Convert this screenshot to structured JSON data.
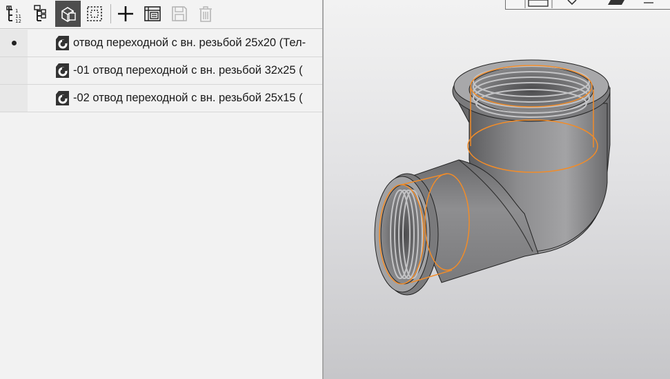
{
  "toolbar": {
    "buttons": [
      {
        "icon": "tree-numbered-icon"
      },
      {
        "icon": "tree-structure-icon"
      },
      {
        "icon": "part-view-icon",
        "active": true
      },
      {
        "icon": "selection-frame-icon"
      },
      {
        "icon": "add-icon"
      },
      {
        "icon": "table-properties-icon"
      },
      {
        "icon": "save-icon",
        "disabled": true
      },
      {
        "icon": "delete-icon",
        "disabled": true
      }
    ]
  },
  "tree": {
    "items": [
      {
        "label": "отвод переходной с вн. резьбой 25x20 (Тел-",
        "current": true
      },
      {
        "label": "-01 отвод переходной с вн. резьбой 32x25 (",
        "current": false
      },
      {
        "label": "-02 отвод переходной с вн. резьбой 25x15 (",
        "current": false
      }
    ]
  },
  "viewport": {
    "model": "elbow-fitting-3d",
    "highlight_color": "#f28c28",
    "body_color": "#8f8f8f"
  }
}
